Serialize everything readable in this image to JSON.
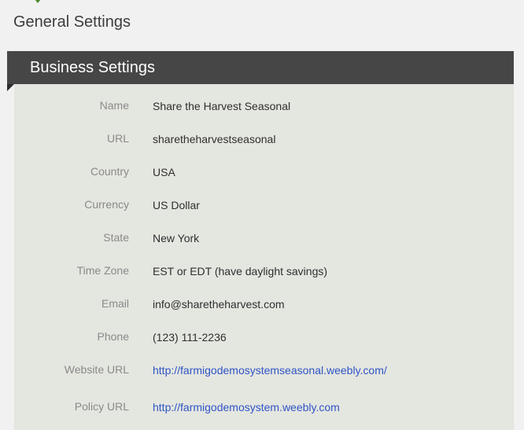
{
  "page": {
    "title": "General Settings"
  },
  "section": {
    "title": "Business Settings"
  },
  "fields": [
    {
      "label": "Name",
      "value": "Share the Harvest Seasonal"
    },
    {
      "label": "URL",
      "value": "sharetheharvestseasonal"
    },
    {
      "label": "Country",
      "value": "USA"
    },
    {
      "label": "Currency",
      "value": "US Dollar"
    },
    {
      "label": "State",
      "value": "New York"
    },
    {
      "label": "Time Zone",
      "value": "EST or EDT (have daylight savings)"
    },
    {
      "label": "Email",
      "value": "info@sharetheharvest.com"
    },
    {
      "label": "Phone",
      "value": "(123) 111-2236"
    },
    {
      "label": "Website URL",
      "value": "http://farmigodemosystemseasonal.weebly.com/"
    },
    {
      "label": "Policy URL",
      "value": "http://farmigodemosystem.weebly.com"
    }
  ],
  "colors": {
    "header_bg": "#464646",
    "panel_bg": "#e4e6e0",
    "link": "#2f55c5",
    "accent_green": "#4c8a2c"
  }
}
